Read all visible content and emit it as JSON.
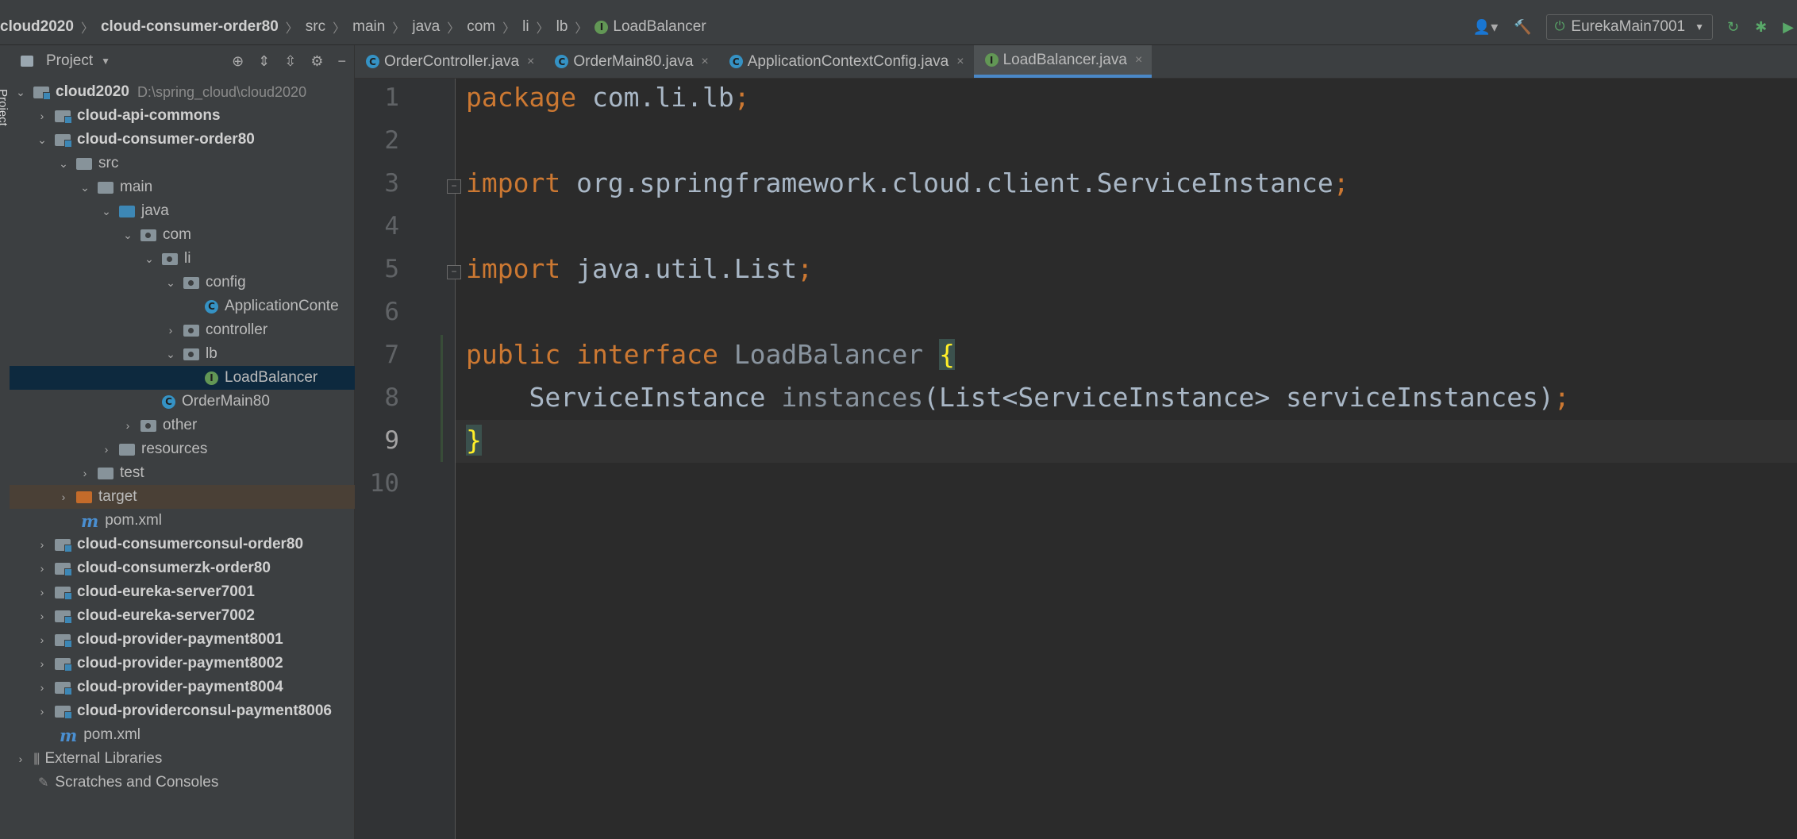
{
  "breadcrumb": {
    "items": [
      "cloud2020",
      "cloud-consumer-order80",
      "src",
      "main",
      "java",
      "com",
      "li",
      "lb"
    ],
    "current": "LoadBalancer",
    "current_badge": "I"
  },
  "toolbar": {
    "run_config": "EurekaMain7001"
  },
  "project_panel": {
    "title": "Project",
    "stripe_label": "Project"
  },
  "tree": {
    "root_label": "cloud2020",
    "root_path": "D:\\spring_cloud\\cloud2020",
    "api_commons": "cloud-api-commons",
    "consumer_order80": "cloud-consumer-order80",
    "src": "src",
    "main": "main",
    "java": "java",
    "com": "com",
    "li": "li",
    "config": "config",
    "app_context": "ApplicationConte",
    "controller": "controller",
    "lb": "lb",
    "load_balancer": "LoadBalancer",
    "order_main": "OrderMain80",
    "other": "other",
    "resources": "resources",
    "test": "test",
    "target": "target",
    "pom_inner": "pom.xml",
    "consumerconsul": "cloud-consumerconsul-order80",
    "consumerzk": "cloud-consumerzk-order80",
    "eureka7001": "cloud-eureka-server7001",
    "eureka7002": "cloud-eureka-server7002",
    "payment8001": "cloud-provider-payment8001",
    "payment8002": "cloud-provider-payment8002",
    "payment8004": "cloud-provider-payment8004",
    "consulpayment8006": "cloud-providerconsul-payment8006",
    "pom_root": "pom.xml",
    "external_libraries": "External Libraries",
    "scratches": "Scratches and Consoles"
  },
  "tabs": [
    {
      "label": "OrderController.java",
      "badge": "C"
    },
    {
      "label": "OrderMain80.java",
      "badge": "C"
    },
    {
      "label": "ApplicationContextConfig.java",
      "badge": "C"
    },
    {
      "label": "LoadBalancer.java",
      "badge": "I"
    }
  ],
  "editor": {
    "line_numbers": [
      "1",
      "2",
      "3",
      "4",
      "5",
      "6",
      "7",
      "8",
      "9",
      "10"
    ],
    "current_line": "9",
    "code": {
      "l1_kw": "package",
      "l1_rest": " com.li.lb",
      "l3_kw": "import",
      "l3_rest": " org.springframework.cloud.client.ServiceInstance",
      "l5_kw": "import",
      "l5_rest": " java.util.List",
      "l7_kw": "public interface",
      "l7_name": "LoadBalancer",
      "l7_brace": "{",
      "l8_type": "ServiceInstance",
      "l8_method": "instances",
      "l8_params": "(List<ServiceInstance> serviceInstances)",
      "l9_brace": "}",
      "semicolon": ";"
    }
  },
  "colors": {
    "keyword": "#cc7832",
    "text": "#a9b7c6",
    "brace_highlight": "#ffef28",
    "active_tab_underline": "#4a88c7",
    "interface_badge": "#629755",
    "class_badge": "#3592c4"
  }
}
